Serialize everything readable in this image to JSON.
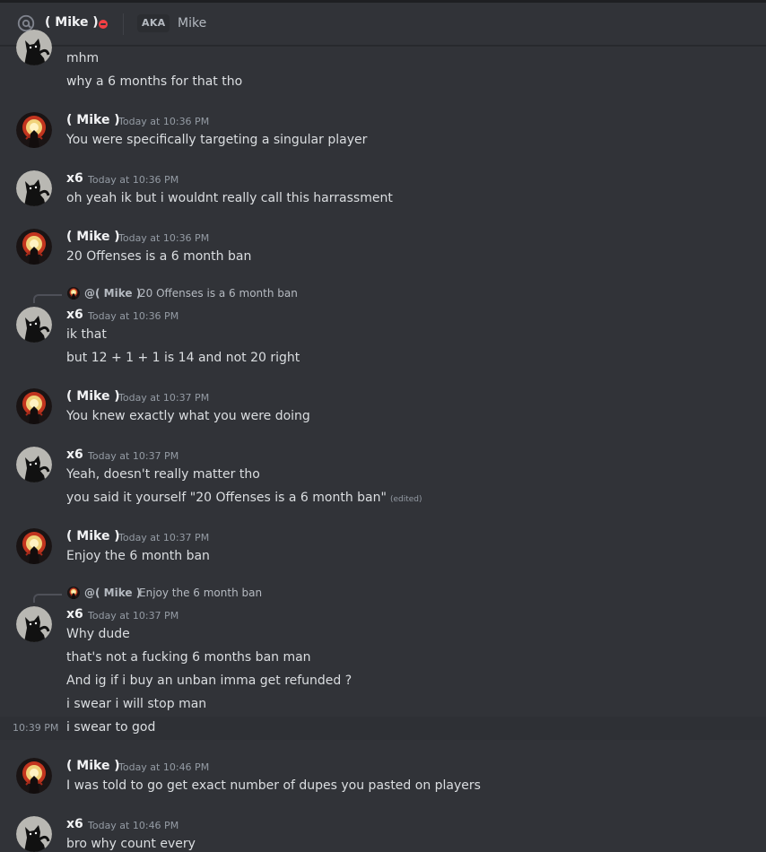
{
  "header": {
    "name": "( Mike )",
    "aka_badge": "AKA",
    "aka_name": "Mike",
    "status": "do-not-disturb"
  },
  "colors": {
    "background": "#313338",
    "dnd": "#f23f43",
    "text": "#dbdee1",
    "muted": "#949ba4"
  },
  "messages": {
    "m0": {
      "lines": [
        "mhm",
        "why a 6 months for that tho"
      ]
    },
    "m1": {
      "author": "( Mike )",
      "time": "Today at 10:36 PM",
      "lines": [
        "You were specifically targeting a singular player"
      ]
    },
    "m2": {
      "author": "x6",
      "time": "Today at 10:36 PM",
      "lines": [
        "oh yeah ik but i wouldnt really call this harrassment"
      ]
    },
    "m3": {
      "author": "( Mike )",
      "time": "Today at 10:36 PM",
      "lines": [
        "20 Offenses is a 6 month ban"
      ]
    },
    "m4": {
      "reply_name": "@( Mike )",
      "reply_text": "20 Offenses is a 6 month ban",
      "author": "x6",
      "time": "Today at 10:36 PM",
      "lines": [
        "ik that",
        "but 12 + 1 + 1 is 14 and not 20 right"
      ]
    },
    "m5": {
      "author": "( Mike )",
      "time": "Today at 10:37 PM",
      "lines": [
        "You knew exactly what you were doing"
      ]
    },
    "m6": {
      "author": "x6",
      "time": "Today at 10:37 PM",
      "lines": [
        "Yeah, doesn't really matter tho",
        "you said it yourself \"20 Offenses is a 6 month ban\""
      ],
      "edited": "(edited)"
    },
    "m7": {
      "author": "( Mike )",
      "time": "Today at 10:37 PM",
      "lines": [
        "Enjoy the 6 month ban"
      ]
    },
    "m8": {
      "reply_name": "@( Mike )",
      "reply_text": "Enjoy the 6 month ban",
      "author": "x6",
      "time": "Today at 10:37 PM",
      "lines": [
        "Why dude",
        "that's not a fucking 6 months ban man",
        "And ig if i buy an unban imma get refunded ?",
        "i swear i will stop man",
        "i swear to god"
      ],
      "side_time": "10:39 PM"
    },
    "m9": {
      "author": "( Mike )",
      "time": "Today at 10:46 PM",
      "lines": [
        "I was told to go get exact number of dupes you pasted on players"
      ]
    },
    "m10": {
      "author": "x6",
      "time": "Today at 10:46 PM",
      "lines": [
        "bro why count every"
      ]
    }
  }
}
